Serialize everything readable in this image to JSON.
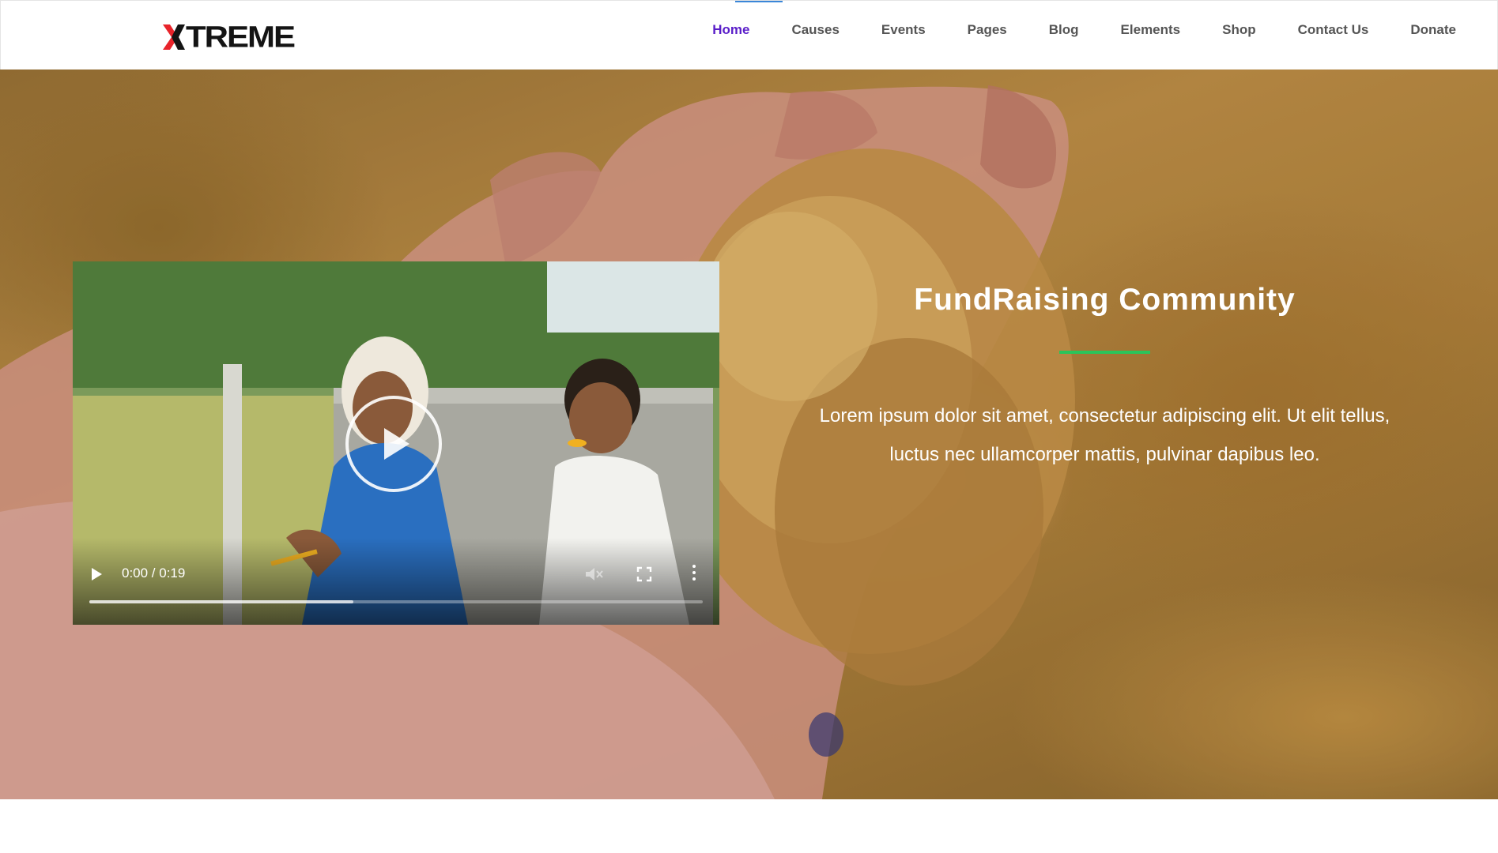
{
  "header": {
    "logo_text": "TREME",
    "nav": [
      {
        "label": "Home",
        "active": true
      },
      {
        "label": "Causes"
      },
      {
        "label": "Events"
      },
      {
        "label": "Pages"
      },
      {
        "label": "Blog"
      },
      {
        "label": "Elements"
      },
      {
        "label": "Shop"
      },
      {
        "label": "Contact Us"
      },
      {
        "label": "Donate"
      }
    ],
    "active_color": "#5a1ec9",
    "indicator_color": "#3a86d8"
  },
  "hero": {
    "title": "FundRaising Community",
    "divider_color": "#2bc45a",
    "body_line1": "Lorem ipsum dolor sit amet, consectetur adipiscing elit. Ut elit tellus,",
    "body_line2": "luctus nec ullamcorper mattis, pulvinar dapibus leo."
  },
  "video": {
    "time": "0:00 / 0:19",
    "buffered_fraction": 0.43,
    "icons": [
      "play-icon",
      "mute-icon",
      "fullscreen-icon",
      "more-options-icon"
    ]
  }
}
